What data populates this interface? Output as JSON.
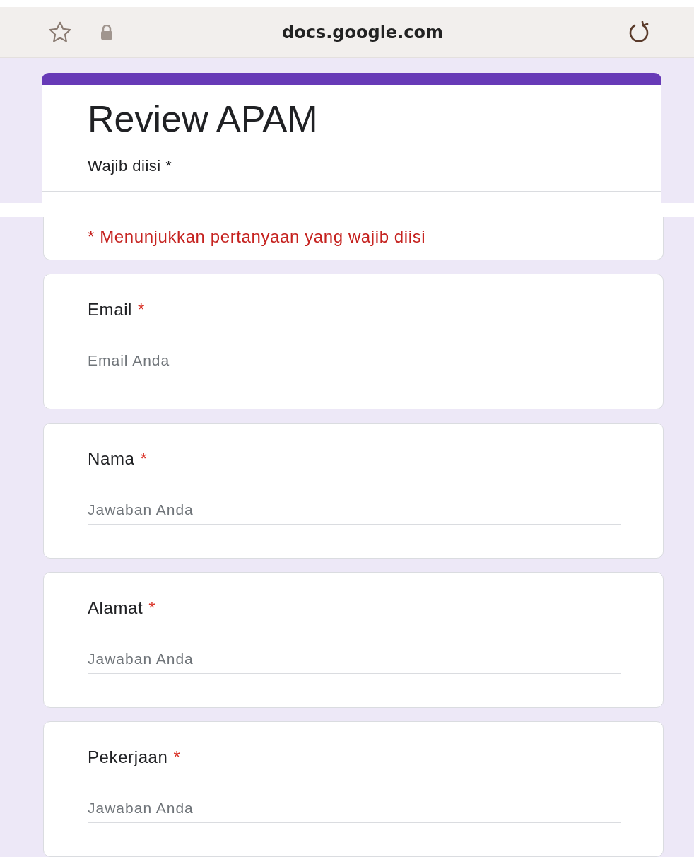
{
  "browser": {
    "url": "docs.google.com"
  },
  "form": {
    "title": "Review APAM",
    "subtitle": "Wajib diisi *",
    "notice": "* Menunjukkan pertanyaan yang wajib diisi"
  },
  "questions": [
    {
      "label": "Email",
      "mark": "*",
      "placeholder": "Email Anda"
    },
    {
      "label": "Nama",
      "mark": "*",
      "placeholder": "Jawaban Anda"
    },
    {
      "label": "Alamat",
      "mark": "*",
      "placeholder": "Jawaban Anda"
    },
    {
      "label": "Pekerjaan",
      "mark": "*",
      "placeholder": "Jawaban Anda"
    }
  ]
}
